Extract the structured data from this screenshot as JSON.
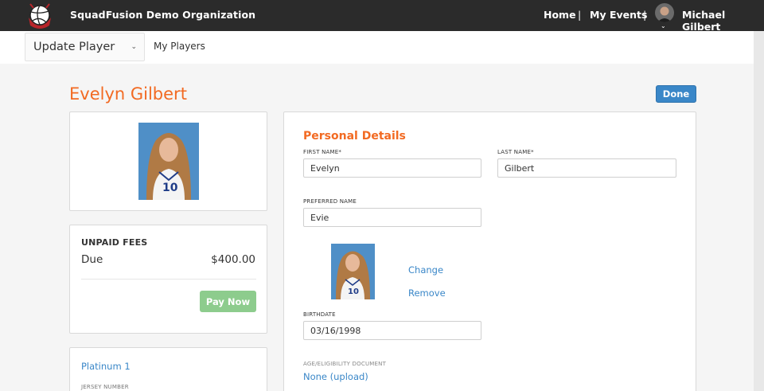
{
  "header": {
    "org_name": "SquadFusion Demo Organization",
    "nav": {
      "home": "Home",
      "my_events": "My Events",
      "sep": "|"
    },
    "user_name": "Michael Gilbert",
    "caret": "⌄"
  },
  "subbar": {
    "page_select": "Update Player",
    "page_select_caret": "⌄",
    "my_players": "My Players"
  },
  "player": {
    "name": "Evelyn Gilbert",
    "done_label": "Done"
  },
  "fees": {
    "title": "UNPAID FEES",
    "due_label": "Due",
    "due_amount": "$400.00",
    "pay_label": "Pay Now"
  },
  "team": {
    "name": "Platinum 1",
    "jersey_label": "JERSEY NUMBER"
  },
  "details": {
    "section_title": "Personal Details",
    "first_name_label": "FIRST NAME*",
    "first_name": "Evelyn",
    "last_name_label": "LAST NAME*",
    "last_name": "Gilbert",
    "preferred_label": "PREFERRED NAME",
    "preferred": "Evie",
    "change_label": "Change",
    "remove_label": "Remove",
    "birthdate_label": "BIRTHDATE",
    "birthdate": "03/16/1998",
    "doc_label": "AGE/ELIGIBILITY DOCUMENT",
    "doc_link": "None (upload)"
  },
  "colors": {
    "accent_orange": "#f26a22",
    "link_blue": "#3a87c8",
    "pay_green": "#8dcc8d",
    "navbar": "#2b2b2b"
  },
  "icons": {
    "logo": "volleyball-logo-icon",
    "avatar": "user-avatar",
    "select_caret": "chevron-down-icon",
    "player_photo": "player-photo"
  }
}
